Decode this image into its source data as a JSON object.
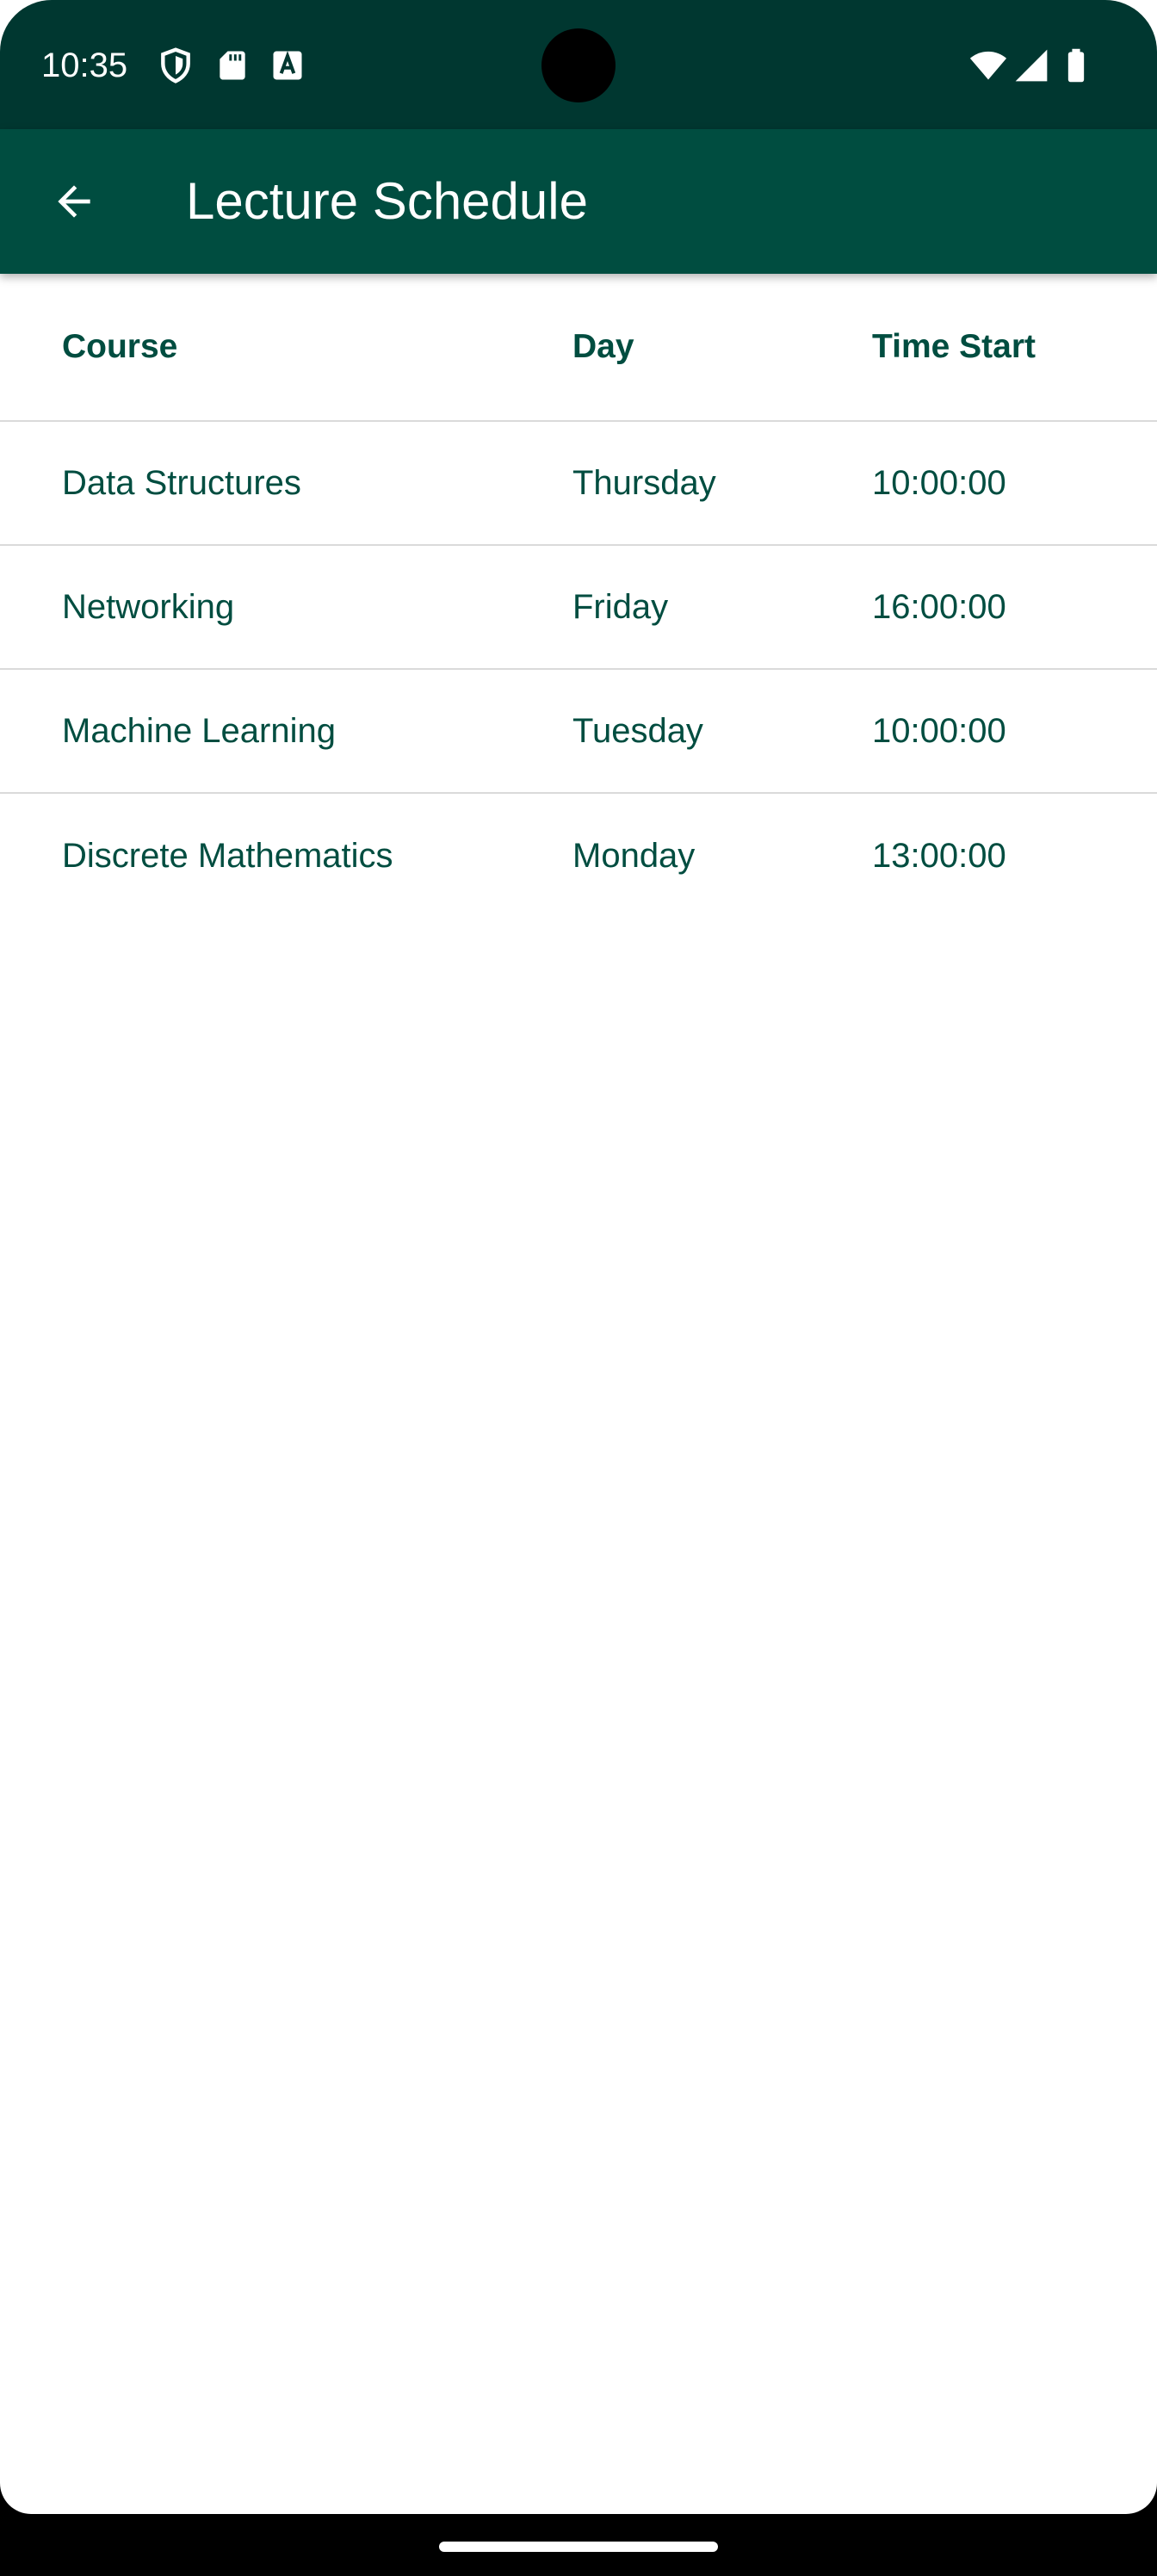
{
  "status_bar": {
    "time": "10:35",
    "icons": [
      "shield-icon",
      "sd-card-icon",
      "font-a-icon",
      "wifi-icon",
      "cell-signal-icon",
      "battery-icon"
    ]
  },
  "app_bar": {
    "back_icon": "arrow-back-icon",
    "title": "Lecture Schedule"
  },
  "table": {
    "headers": {
      "course": "Course",
      "day": "Day",
      "time_start": "Time Start"
    },
    "rows": [
      {
        "course": "Data Structures",
        "day": "Thursday",
        "time_start": "10:00:00"
      },
      {
        "course": "Networking",
        "day": "Friday",
        "time_start": "16:00:00"
      },
      {
        "course": "Machine Learning",
        "day": "Tuesday",
        "time_start": "10:00:00"
      },
      {
        "course": "Discrete Mathematics",
        "day": "Monday",
        "time_start": "13:00:00"
      }
    ]
  },
  "colors": {
    "status_bar": "#003730",
    "app_bar": "#004d40",
    "text_primary": "#004d40",
    "divider": "#dadada",
    "background": "#ffffff"
  }
}
